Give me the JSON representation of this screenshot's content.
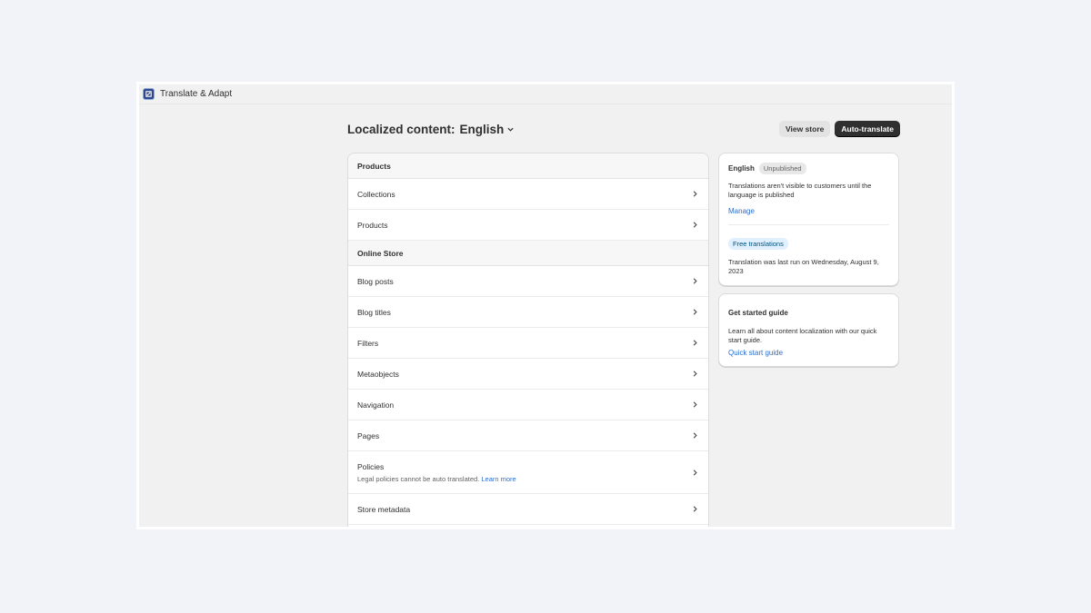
{
  "app": {
    "title": "Translate & Adapt"
  },
  "header": {
    "heading_label": "Localized content:",
    "language": "English",
    "view_store_label": "View store",
    "auto_translate_label": "Auto-translate"
  },
  "list": {
    "section_products": "Products",
    "collections": "Collections",
    "products": "Products",
    "section_online_store": "Online Store",
    "blog_posts": "Blog posts",
    "blog_titles": "Blog titles",
    "filters": "Filters",
    "metaobjects": "Metaobjects",
    "navigation": "Navigation",
    "pages": "Pages",
    "policies": "Policies",
    "policies_note": "Legal policies cannot be auto translated.",
    "policies_link": "Learn more",
    "store_metadata": "Store metadata"
  },
  "status_card": {
    "language": "English",
    "badge": "Unpublished",
    "note": "Translations aren't visible to customers until the language is published",
    "manage_link": "Manage",
    "free_badge": "Free translations",
    "last_run": "Translation was last run on Wednesday, August 9, 2023"
  },
  "guide_card": {
    "title": "Get started guide",
    "text": "Learn all about content localization with our quick start guide.",
    "link": "Quick start guide"
  },
  "icons": {
    "logo": "app-logo-icon",
    "chevron": "chevron-right-icon",
    "dropdown": "chevron-down-icon"
  },
  "colors": {
    "primary_button": "#303030",
    "link": "#2c6ecb",
    "info_badge": "#e0f0ff"
  }
}
